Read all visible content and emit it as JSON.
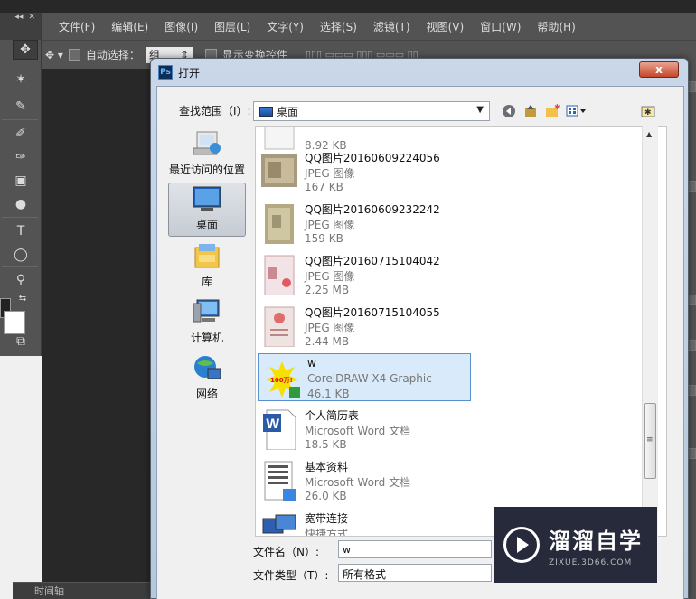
{
  "menubar": {
    "items": [
      "文件(F)",
      "编辑(E)",
      "图像(I)",
      "图层(L)",
      "文字(Y)",
      "选择(S)",
      "滤镜(T)",
      "视图(V)",
      "窗口(W)",
      "帮助(H)"
    ]
  },
  "options": {
    "auto_select_label": "自动选择：",
    "auto_select_value": "组",
    "show_transform_label": "显示变换控件"
  },
  "timeline_label": "时间轴",
  "dialog": {
    "title": "打开",
    "close": "x",
    "lookin_label": "查找范围（I）:",
    "lookin_value": "桌面",
    "places": [
      {
        "label": "最近访问的位置",
        "icon": "recent-places-icon"
      },
      {
        "label": "桌面",
        "icon": "desktop-icon"
      },
      {
        "label": "库",
        "icon": "library-icon"
      },
      {
        "label": "计算机",
        "icon": "computer-icon"
      },
      {
        "label": "网络",
        "icon": "network-icon"
      }
    ],
    "files": [
      {
        "name": "",
        "type": "",
        "size": "8.92 KB"
      },
      {
        "name": "QQ图片20160609224056",
        "type": "JPEG 图像",
        "size": "167 KB"
      },
      {
        "name": "QQ图片20160609232242",
        "type": "JPEG 图像",
        "size": "159 KB"
      },
      {
        "name": "QQ图片20160715104042",
        "type": "JPEG 图像",
        "size": "2.25 MB"
      },
      {
        "name": "QQ图片20160715104055",
        "type": "JPEG 图像",
        "size": "2.44 MB"
      },
      {
        "name": "w",
        "type": "CorelDRAW X4 Graphic",
        "size": "46.1 KB",
        "thumb_text": "100万!"
      },
      {
        "name": "个人简历表",
        "type": "Microsoft Word 文档",
        "size": "18.5 KB"
      },
      {
        "name": "基本资料",
        "type": "Microsoft Word 文档",
        "size": "26.0 KB"
      },
      {
        "name": "宽带连接",
        "type": "快捷方式",
        "size": ""
      }
    ],
    "filename_label": "文件名（N）:",
    "filename_value": "w",
    "filetype_label": "文件类型（T）:",
    "filetype_value": "所有格式"
  },
  "watermark": {
    "title": "溜溜自学",
    "subtitle": "ZIXUE.3D66.COM"
  }
}
